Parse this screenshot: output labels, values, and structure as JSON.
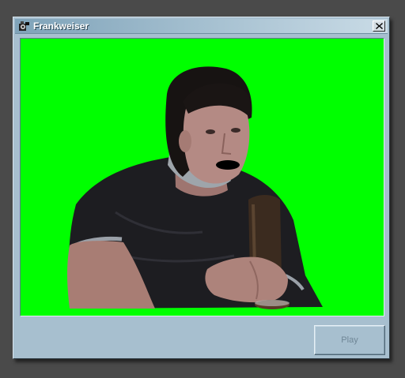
{
  "window": {
    "title": "Frankweiser",
    "icon": "app-icon",
    "close_icon": "close-icon"
  },
  "video": {
    "background_color": "#00ff00"
  },
  "controls": {
    "play_label": "Play",
    "play_enabled": false
  }
}
